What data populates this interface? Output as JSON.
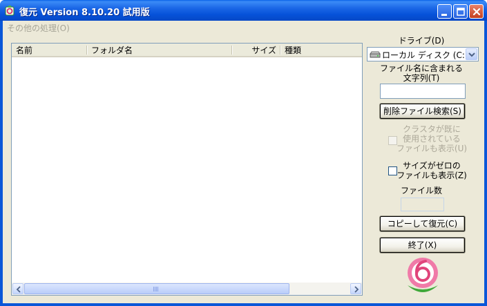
{
  "window": {
    "title": "復元 Version 8.10.20 試用版"
  },
  "menu": {
    "other_processing": "その他の処理(O)"
  },
  "list": {
    "columns": [
      "名前",
      "フォルダ名",
      "サイズ",
      "種類"
    ],
    "rows": []
  },
  "drive": {
    "label": "ドライブ(D)",
    "selected": "ローカル ディスク (C:)"
  },
  "filename_filter": {
    "label_line1": "ファイル名に含まれる",
    "label_line2": "文字列(T)",
    "value": ""
  },
  "buttons": {
    "search": "削除ファイル検索(S)",
    "copy_restore": "コピーして復元(C)",
    "exit": "終了(X)"
  },
  "options": {
    "cluster_used_line1": "クラスタが既に",
    "cluster_used_line2": "使用されている",
    "cluster_used_line3": "ファイルも表示(U)",
    "cluster_used_enabled": false,
    "zero_size_line1": "サイズがゼロの",
    "zero_size_line2": "ファイルも表示(Z)",
    "zero_size_checked": false
  },
  "file_count": {
    "label": "ファイル数",
    "value": ""
  },
  "colors": {
    "title_bar": "#0a57d8",
    "window_bg": "#ece9d8",
    "close_button": "#d45a36",
    "logo_pink": "#e0457b",
    "logo_green": "#3fa83a"
  },
  "icons": {
    "app": "app-icon",
    "drive": "hard-drive-icon",
    "minimize": "minimize-icon",
    "maximize": "maximize-icon",
    "close": "close-icon",
    "logo": "restore-logo-icon"
  }
}
